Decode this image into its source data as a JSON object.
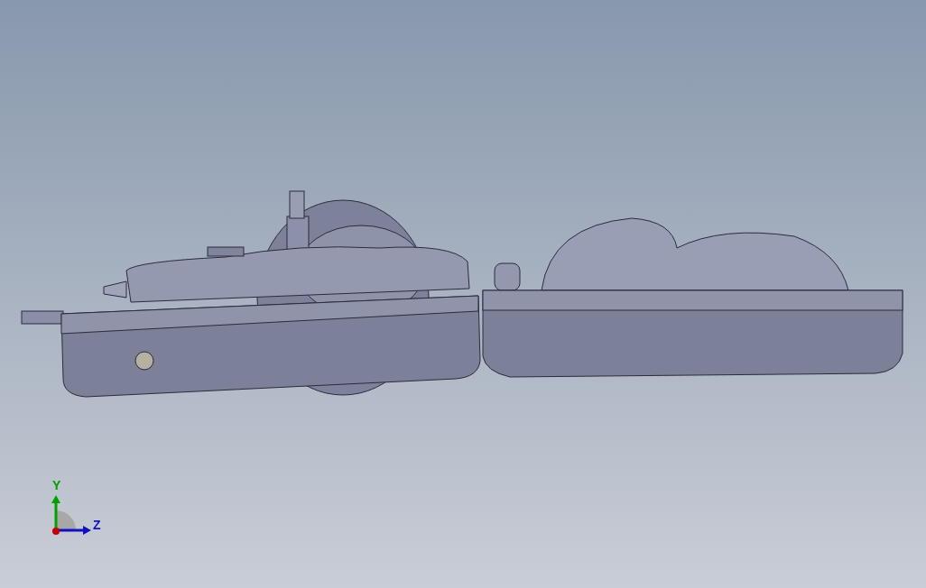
{
  "triad": {
    "axes": [
      {
        "label": "Y",
        "color": "#00a000"
      },
      {
        "label": "Z",
        "color": "#1010c0"
      }
    ]
  }
}
